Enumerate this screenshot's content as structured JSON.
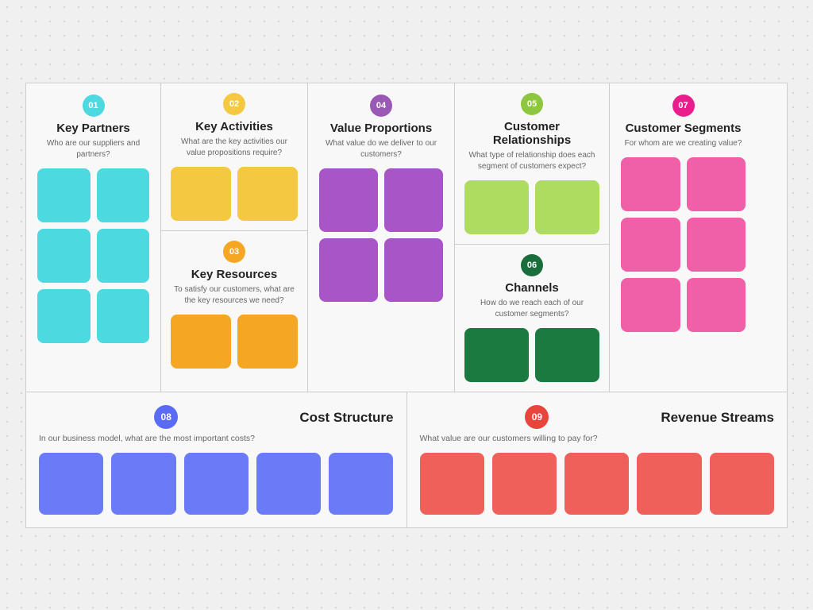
{
  "cells": {
    "keyPartners": {
      "badge": "01",
      "badgeColor": "#4DD9E0",
      "title": "Key Partners",
      "desc": "Who are our suppliers and partners?",
      "cardColor": "#4DD9E0",
      "cardsCount": 6
    },
    "keyActivities": {
      "badge": "02",
      "badgeColor": "#F5C842",
      "title": "Key Activities",
      "desc": "What are the key activities our value propositions require?",
      "cardColor": "#F5C842",
      "cardsCount": 2
    },
    "keyResources": {
      "badge": "03",
      "badgeColor": "#F5A623",
      "title": "Key Resources",
      "desc": "To satisfy our customers, what are the key resources we need?",
      "cardColor": "#F5A623",
      "cardsCount": 2
    },
    "valueProportions": {
      "badge": "04",
      "badgeColor": "#9B59B6",
      "title": "Value Proportions",
      "desc": "What value do we deliver to our customers?",
      "cardColor": "#A855C8",
      "cardsCount": 4
    },
    "customerRelationships": {
      "badge": "05",
      "badgeColor": "#8DC63F",
      "title": "Customer Relationships",
      "desc": "What type of relationship does each segment of customers expect?",
      "cardColor": "#AEDC60",
      "cardsCount": 2
    },
    "channels": {
      "badge": "06",
      "badgeColor": "#1A6E3C",
      "title": "Channels",
      "desc": "How do we reach each of our customer segments?",
      "cardColor": "#1A7A40",
      "cardsCount": 2
    },
    "customerSegments": {
      "badge": "07",
      "badgeColor": "#E91E8C",
      "title": "Customer Segments",
      "desc": "For whom are we creating value?",
      "cardColor": "#F060A8",
      "cardsCount": 6
    },
    "costStructure": {
      "badge": "08",
      "badgeColor": "#5A6BF5",
      "title": "Cost Structure",
      "desc": "In our business model, what are the most important costs?",
      "cardColor": "#6B7BF7",
      "cardsCount": 5
    },
    "revenueStreams": {
      "badge": "09",
      "badgeColor": "#E8453C",
      "title": "Revenue Streams",
      "desc": "What value are our customers willing to pay for?",
      "cardColor": "#F0605A",
      "cardsCount": 5
    }
  }
}
